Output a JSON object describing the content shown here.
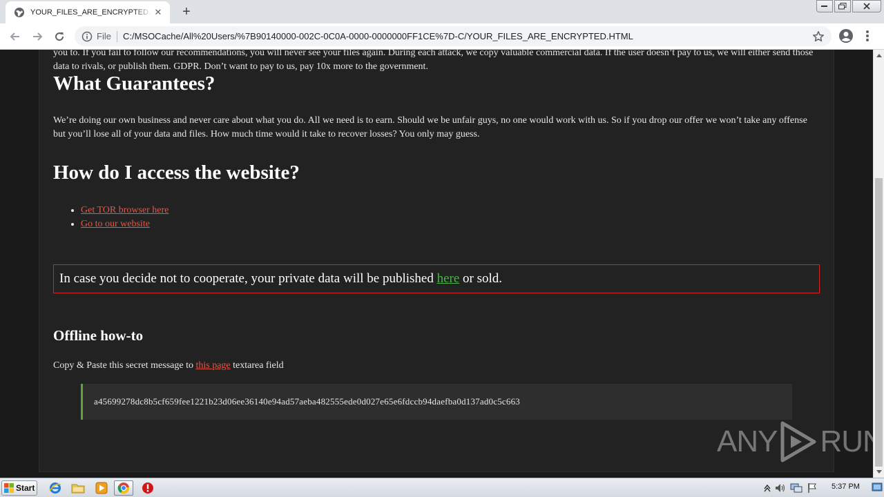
{
  "browser": {
    "tab_title": "YOUR_FILES_ARE_ENCRYPTED.HTML",
    "tab_close": "✕",
    "new_tab": "+",
    "scheme_label": "File",
    "url": "C:/MSOCache/All%20Users/%7B90140000-002C-0C0A-0000-0000000FF1CE%7D-C/YOUR_FILES_ARE_ENCRYPTED.HTML"
  },
  "page": {
    "intro_paragraph": "you to. If you fail to follow our recommendations, you will never see your files again. During each attack, we copy valuable commercial data. If the user doesn’t pay to us, we will either send those data to rivals, or publish them. GDPR. Don’t want to pay to us, pay 10x more to the government.",
    "guarantees_heading": "What Guarantees?",
    "guarantees_paragraph": "We’re doing our own business and never care about what you do. All we need is to earn. Should we be unfair guys, no one would work with us. So if you drop our offer we won’t take any offense but you’ll lose all of your data and files. How much time would it take to recover losses? You only may guess.",
    "access_heading": "How do I access the website?",
    "links": [
      "Get TOR browser here",
      "Go to our website"
    ],
    "warning": {
      "before": "In case you decide not to cooperate, your private data will be published ",
      "link": "here",
      "after": " or sold."
    },
    "offline_heading": "Offline how-to",
    "copy_instruction": {
      "before": "Copy & Paste this secret message to ",
      "link": "this page",
      "after": " textarea field"
    },
    "secret_message": "a45699278dc8b5cf659fee1221b23d06ee36140e94ad57aeba482555ede0d027e65e6fdccb94daefba0d137ad0c5c663"
  },
  "watermark": {
    "left": "ANY",
    "right": "RUN"
  },
  "taskbar": {
    "start_label": "Start",
    "clock": "5:37 PM"
  },
  "colors": {
    "page_bg": "#1a1a1a",
    "card_bg": "#222222",
    "link": "#e0584a",
    "warning_border": "#d42424",
    "green_link": "#4cb24c",
    "code_accent": "#5fa63a"
  }
}
